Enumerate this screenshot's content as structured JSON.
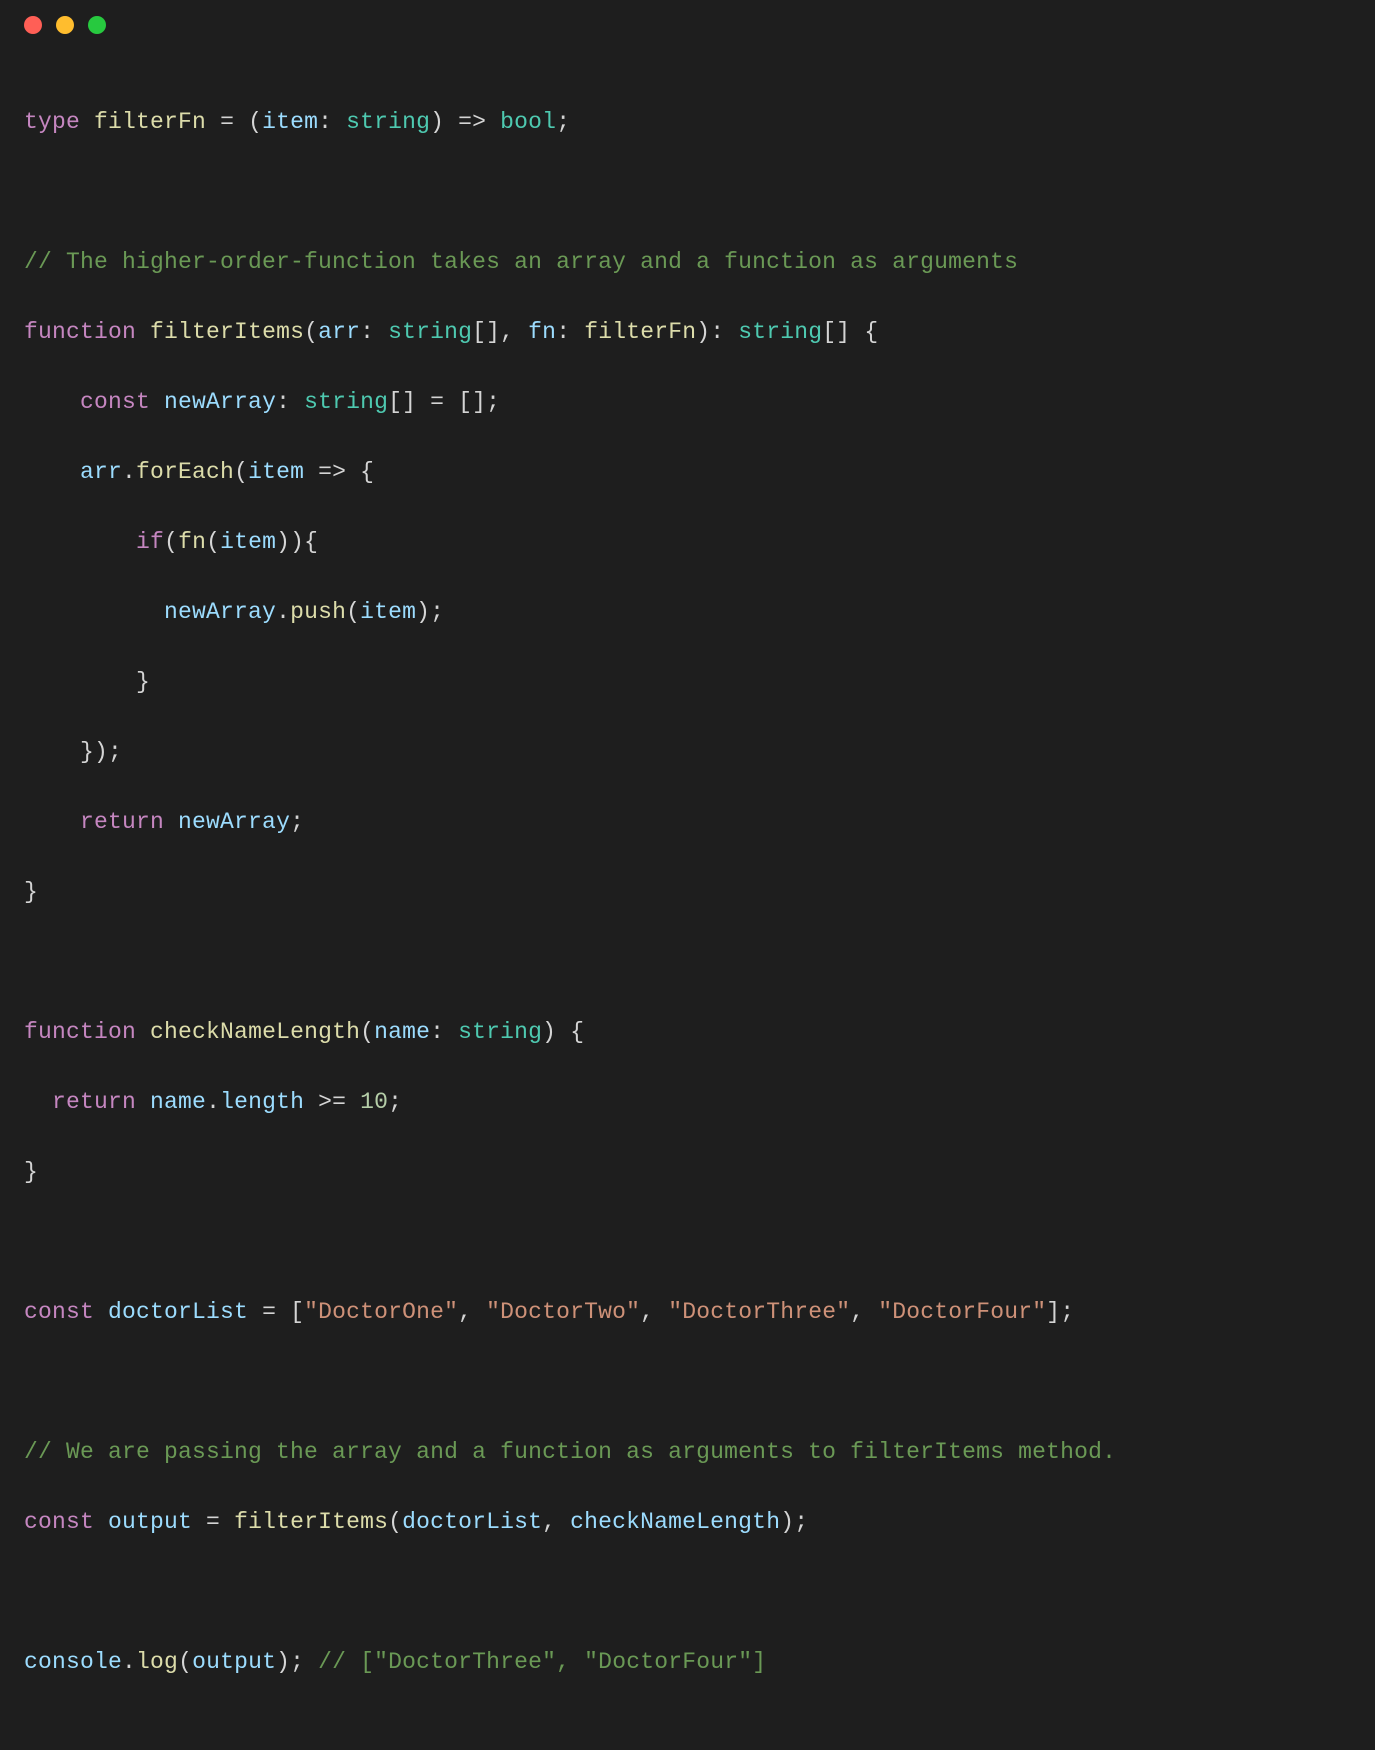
{
  "window": {
    "traffic": {
      "red": "#ff5f56",
      "yellow": "#ffbd2e",
      "green": "#27c93f"
    }
  },
  "t": {
    "kw_type": "type",
    "kw_function": "function",
    "kw_const": "const",
    "kw_return": "return",
    "kw_if": "if",
    "typ_string": "string",
    "typ_bool": "bool",
    "filterFn": "filterFn",
    "filterItems": "filterItems",
    "checkNameLength": "checkNameLength",
    "item": "item",
    "arr": "arr",
    "fn": "fn",
    "newArray": "newArray",
    "forEach": "forEach",
    "push": "push",
    "name": "name",
    "length": "length",
    "doctorList": "doctorList",
    "output": "output",
    "console": "console",
    "log": "log",
    "num_10": "10",
    "str_d1": "\"DoctorOne\"",
    "str_d2": "\"DoctorTwo\"",
    "str_d3": "\"DoctorThree\"",
    "str_d4": "\"DoctorFour\"",
    "cmt1": "// The higher-order-function takes an array and a function as arguments",
    "cmt2": "// We are passing the array and a function as arguments to filterItems method.",
    "cmt3": "// [\"DoctorThree\", \"DoctorFour\"]",
    "sp": " ",
    "eq": " = ",
    "arrow": " => ",
    "gte": " >= ",
    "colon_sp": ": ",
    "lparen": "(",
    "rparen": ")",
    "lbrace": "{",
    "rbrace": "}",
    "lbracket": "[",
    "rbracket": "]",
    "brackets": "[]",
    "semi": ";",
    "comma_sp": ", ",
    "dot": "."
  }
}
